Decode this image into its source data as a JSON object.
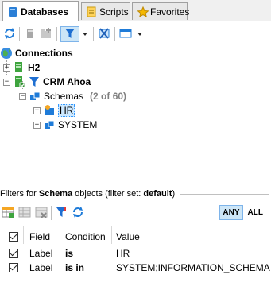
{
  "tabs": [
    {
      "label": "Databases",
      "active": true,
      "icon": "database-icon"
    },
    {
      "label": "Scripts",
      "active": false,
      "icon": "script-icon"
    },
    {
      "label": "Favorites",
      "active": false,
      "icon": "star-icon"
    }
  ],
  "toolbar": {
    "buttons": [
      "refresh-icon",
      "new-connection-icon",
      "new-folder-icon",
      "filter-icon",
      "dropdown-icon",
      "disconnect-icon",
      "window-icon",
      "dropdown-icon"
    ]
  },
  "tree": {
    "root": {
      "label": "Connections"
    },
    "h2": {
      "label": "H2"
    },
    "crm": {
      "label": "CRM Ahoa"
    },
    "schemas": {
      "label": "Schemas",
      "count": "(2 of 60)"
    },
    "hr": {
      "label": "HR"
    },
    "system": {
      "label": "SYSTEM"
    }
  },
  "filter": {
    "prefix": "Filters for ",
    "object": "Schema",
    "middle": " objects (filter set: ",
    "set": "default",
    "suffix": ")",
    "any_label": "ANY",
    "all_label": "ALL"
  },
  "grid": {
    "headers": {
      "field": "Field",
      "condition": "Condition",
      "value": "Value"
    },
    "rows": [
      {
        "field": "Label",
        "condition": "is",
        "value": "HR"
      },
      {
        "field": "Label",
        "condition": "is in",
        "value": "SYSTEM;INFORMATION_SCHEMA"
      }
    ]
  },
  "colors": {
    "accent": "#1e7bd8",
    "selection": "#cde6f7",
    "filter_funnel": "#1f6fd1",
    "connection_green": "#3ea43e"
  }
}
